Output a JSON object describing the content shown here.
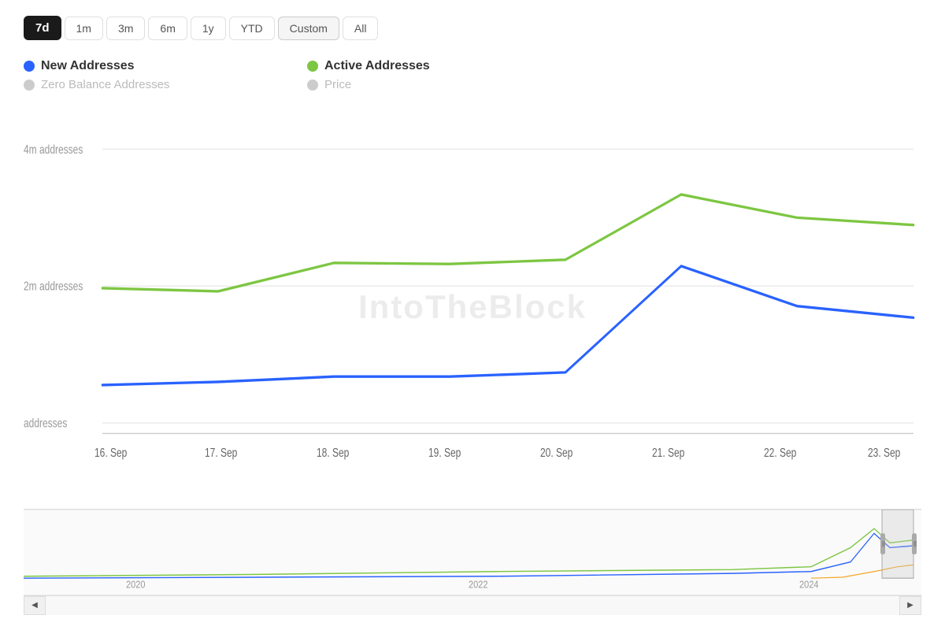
{
  "timeRange": {
    "buttons": [
      {
        "label": "7d",
        "active": true
      },
      {
        "label": "1m",
        "active": false
      },
      {
        "label": "3m",
        "active": false
      },
      {
        "label": "6m",
        "active": false
      },
      {
        "label": "1y",
        "active": false
      },
      {
        "label": "YTD",
        "active": false
      },
      {
        "label": "Custom",
        "active": false,
        "custom": true
      },
      {
        "label": "All",
        "active": false
      }
    ]
  },
  "legend": {
    "items": [
      {
        "label": "New Addresses",
        "color": "#2962FF",
        "active": true,
        "id": "new-addresses"
      },
      {
        "label": "Active Addresses",
        "color": "#7DC642",
        "active": true,
        "id": "active-addresses"
      },
      {
        "label": "Zero Balance Addresses",
        "color": "#ccc",
        "active": false,
        "id": "zero-balance"
      },
      {
        "label": "Price",
        "color": "#ccc",
        "active": false,
        "id": "price"
      }
    ]
  },
  "chart": {
    "yLabels": [
      "4m addresses",
      "2m addresses",
      "addresses"
    ],
    "xLabels": [
      "16. Sep",
      "17. Sep",
      "18. Sep",
      "19. Sep",
      "20. Sep",
      "21. Sep",
      "22. Sep",
      "23. Sep"
    ],
    "watermark": "IntoTheBlock"
  },
  "miniChart": {
    "xLabels": [
      "2020",
      "2022",
      "2024"
    ]
  },
  "nav": {
    "leftArrow": "◀",
    "rightArrow": "▶"
  }
}
